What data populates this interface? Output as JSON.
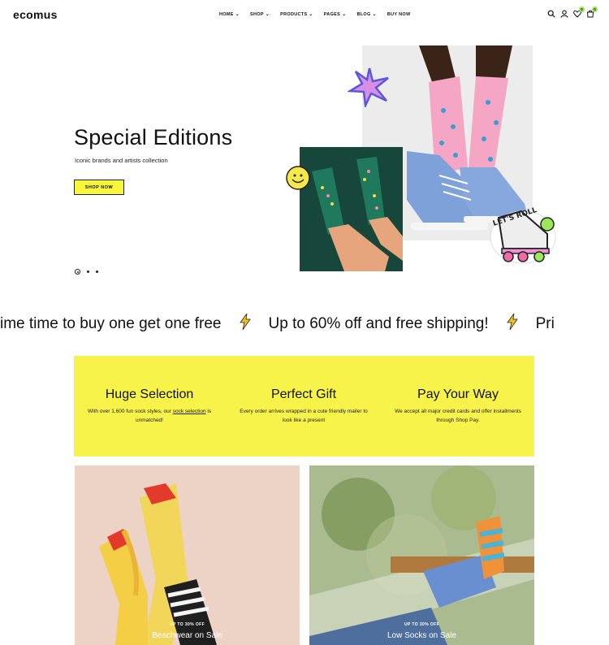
{
  "header": {
    "logo": "ecomus",
    "nav": [
      "HOME",
      "SHOP",
      "PRODUCTS",
      "PAGES",
      "BLOG",
      "BUY NOW"
    ],
    "icons": [
      "search-icon",
      "user-icon",
      "heart-icon",
      "cart-icon"
    ],
    "wishlist_count": "0",
    "cart_count": "0"
  },
  "hero": {
    "title": "Special Editions",
    "subtitle": "Iconic brands and artists collection",
    "button": "SHOP NOW",
    "slides": 3,
    "sticker_text": "LET'S ROLL"
  },
  "marquee": {
    "items": [
      "ime time to buy one get one free",
      "Up to 60% off and free shipping!",
      "Pri"
    ]
  },
  "features": [
    {
      "title": "Huge Selection",
      "desc_before": "With over 1,600 fun sock styles, our ",
      "desc_link": "sock selection",
      "desc_after": " is unmatched!"
    },
    {
      "title": "Perfect Gift",
      "desc_before": "Every order arrives wrapped in a cute friendly mailer to look like a present",
      "desc_link": "",
      "desc_after": ""
    },
    {
      "title": "Pay Your Way",
      "desc_before": "We accept all major credit cards and offer installments through Shop Pay.",
      "desc_link": "",
      "desc_after": ""
    }
  ],
  "promos": [
    {
      "tag": "UP TO 30% OFF",
      "title": "Beachwear on Sale"
    },
    {
      "tag": "UP TO 30% OFF",
      "title": "Low Socks on Sale"
    }
  ],
  "colors": {
    "accent_yellow": "#f7f34a",
    "badge_green": "#9be85a",
    "sock_pink": "#f4a6c4",
    "sneaker_blue": "#7ea1d9",
    "sock_green": "#1f7a5d"
  }
}
